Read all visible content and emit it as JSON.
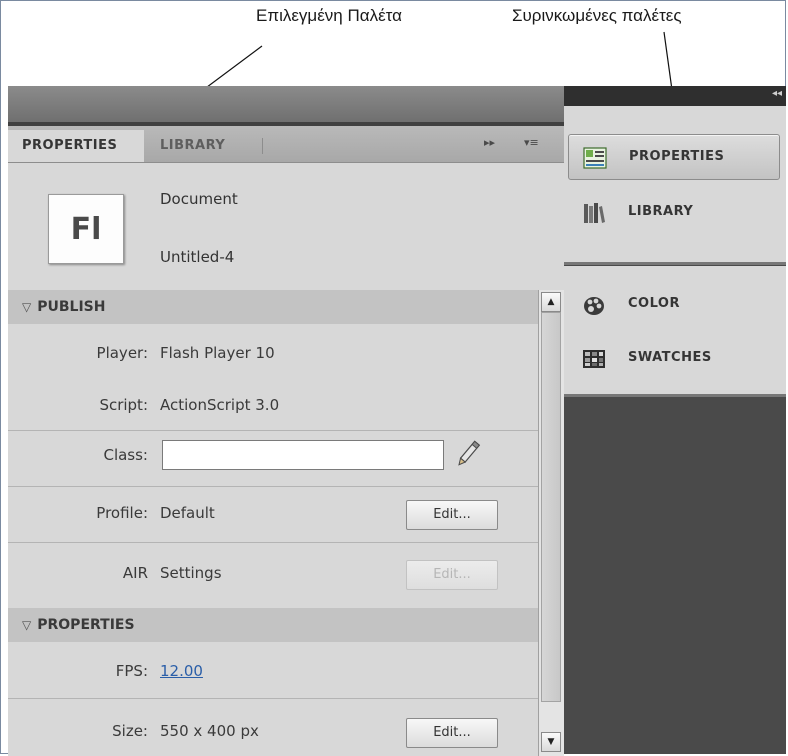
{
  "annotations": {
    "selected_palette": "Επιλεγμένη Παλέτα",
    "collapsed_palettes": "Συρινκωμένες παλέτες"
  },
  "panel": {
    "tabs": {
      "active": "PROPERTIES",
      "inactive": "LIBRARY"
    },
    "tab_controls": {
      "expand": "▸▸",
      "menu": "▾≡"
    },
    "doc": {
      "icon_text": "Fl",
      "type": "Document",
      "name": "Untitled-4"
    },
    "publish": {
      "header": "PUBLISH",
      "player_label": "Player:",
      "player_value": "Flash Player 10",
      "script_label": "Script:",
      "script_value": "ActionScript 3.0",
      "class_label": "Class:",
      "class_value": "",
      "profile_label": "Profile:",
      "profile_value": "Default",
      "profile_button": "Edit...",
      "air_label": "AIR",
      "air_value": "Settings",
      "air_button": "Edit..."
    },
    "properties": {
      "header": "PROPERTIES",
      "fps_label": "FPS:",
      "fps_value": "12.00",
      "size_label": "Size:",
      "size_value": "550 x 400 px",
      "size_button": "Edit..."
    }
  },
  "dock": {
    "arrows": "◂◂",
    "group1": [
      {
        "label": "PROPERTIES",
        "icon": "properties-icon",
        "selected": true
      },
      {
        "label": "LIBRARY",
        "icon": "library-icon",
        "selected": false
      }
    ],
    "group2": [
      {
        "label": "COLOR",
        "icon": "color-icon",
        "selected": false
      },
      {
        "label": "SWATCHES",
        "icon": "swatches-icon",
        "selected": false
      }
    ]
  }
}
